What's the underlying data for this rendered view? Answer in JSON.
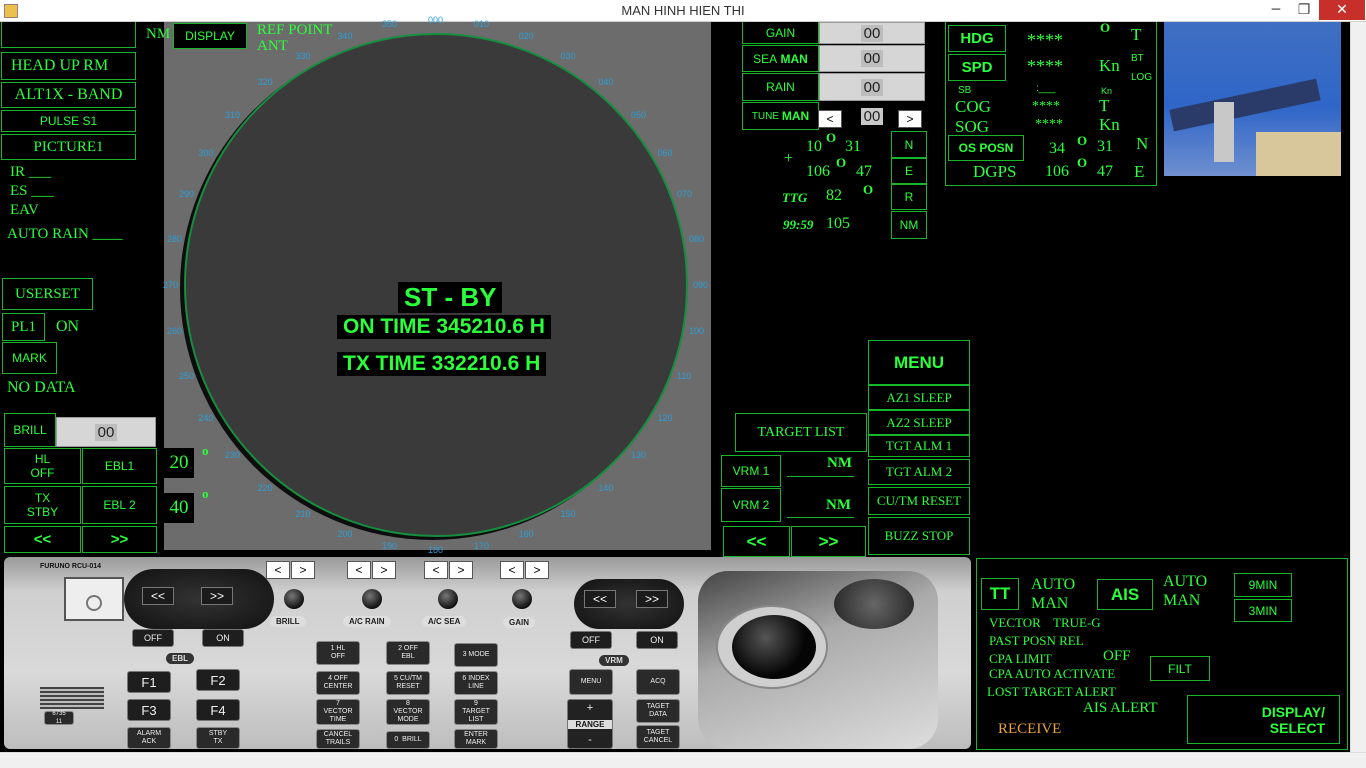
{
  "window": {
    "title": "MAN HINH HIEN THI",
    "min": "─",
    "restore": "❐",
    "close": "✕"
  },
  "left": {
    "nm": "NM",
    "display": "DISPLAY",
    "ref_point": "REF POINT",
    "ant": "ANT",
    "head_up": "HEAD UP  RM",
    "band": "ALT1X - BAND",
    "pulse": "PULSE S1",
    "picture": "PICTURE1",
    "ir": "IR ___",
    "es": "ES ___",
    "eav": "EAV",
    "auto_rain": "AUTO RAIN ____",
    "userset": "USERSET",
    "pl1": "PL1",
    "on": "ON",
    "mark": "MARK",
    "no_data": "NO DATA",
    "brill": "BRILL",
    "brill_val": "00",
    "hl_off": "HL\nOFF",
    "ebl1": "EBL1",
    "tx_stby": "TX\nSTBY",
    "ebl2": "EBL 2",
    "prev": "<<",
    "next": ">>",
    "ebl_deg1": "20",
    "ebl_deg2": "40",
    "deg_sym": "o"
  },
  "scope": {
    "status": "ST - BY",
    "on_time": "ON TIME 345210.6 H",
    "tx_time": "TX TIME 332210.6 H",
    "bearings": [
      "000",
      "010",
      "020",
      "030",
      "040",
      "050",
      "060",
      "070",
      "080",
      "090",
      "100",
      "110",
      "120",
      "130",
      "140",
      "150",
      "160",
      "170",
      "180",
      "190",
      "200",
      "210",
      "220",
      "230",
      "240",
      "250",
      "260",
      "270",
      "280",
      "290",
      "300",
      "310",
      "320",
      "330",
      "340",
      "350"
    ]
  },
  "controls": {
    "gain": "GAIN",
    "gain_val": "00",
    "sea": "SEA",
    "sea_mode": "MAN",
    "sea_val": "00",
    "rain": "RAIN",
    "rain_val": "00",
    "tune": "TUNE",
    "tune_mode": "MAN",
    "tune_val": "00",
    "lt": "<",
    "gt": ">",
    "plus": "+",
    "lat1": "10",
    "lat2": "31",
    "lon1": "106",
    "lon2": "47",
    "ttg": "TTG",
    "ttg_val": "82",
    "time": "99:59",
    "time_val": "105",
    "n": "N",
    "e": "E",
    "r": "R",
    "nm": "NM",
    "deg": "O"
  },
  "nav": {
    "hdg": "HDG",
    "hdg_val": "****",
    "spd": "SPD",
    "spd_val": "****",
    "kn": "Kn",
    "t": "T",
    "bt": "BT",
    "log": "LOG",
    "deg": "O",
    "sb": "SB",
    "sb_val": ":___",
    "kn_small": "Kn",
    "cog": "COG",
    "cog_val": "****",
    "sog": "SOG",
    "sog_val": "****",
    "os_posn": "OS POSN",
    "lat1": "34",
    "lat2": "31",
    "n": "N",
    "dgps": "DGPS",
    "lon1": "106",
    "lon2": "47",
    "e": "E"
  },
  "menu": {
    "title": "MENU",
    "items": [
      "AZ1  SLEEP",
      "AZ2  SLEEP",
      "TGT ALM 1",
      "TGT ALM 2",
      "CU/TM RESET",
      "BUZZ STOP"
    ],
    "target_list": "TARGET LIST",
    "vrm1": "VRM 1",
    "vrm2": "VRM 2",
    "nm": "NM",
    "prev": "<<",
    "next": ">>"
  },
  "ais": {
    "tt": "TT",
    "auto": "AUTO",
    "man": "MAN",
    "ais": "AIS",
    "min9": "9MIN",
    "min3": "3MIN",
    "vector": "VECTOR",
    "true_g": "TRUE-G",
    "past_posn": "PAST POSN REL",
    "cpa_limit": "CPA LIMIT",
    "off": "OFF",
    "filt": "FILT",
    "cpa_auto": "CPA AUTO ACTIVATE",
    "lost_target": "LOST TARGET ALERT",
    "ais_alert": "AIS ALERT",
    "receive": "RECEIVE",
    "display_select": "DISPLAY/\nSELECT"
  },
  "keyboard": {
    "brand": "FURUNO  RCU-014",
    "brill": "BRILL",
    "ac_rain": "A/C RAIN",
    "ac_sea": "A/C SEA",
    "gain": "GAIN",
    "off": "OFF",
    "on": "ON",
    "ebl": "EBL",
    "vrm": "VRM",
    "lt": "<",
    "gt": ">",
    "prev": "<<",
    "next": ">>",
    "f1": "F1",
    "f2": "F2",
    "f3": "F3",
    "f4": "F4",
    "alarm_ack": "ALARM\nACK",
    "stby_tx": "STBY\nTX",
    "k1": "1 HL\nOFF",
    "k2": "2 OFF\nEBL",
    "k3": "3 MODE",
    "k4": "4 OFF\nCENTER",
    "k5": "5 CU/TM\nRESET",
    "k6": "6 INDEX\nLINE",
    "k7": "7\nVECTOR\nTIME",
    "k8": "8\nVECTOR\nMODE",
    "k9": "9\nTARGET\nLIST",
    "k_cancel": "CANCEL\nTRAILS",
    "k0": "0  BRILL",
    "k_enter": "ENTER\nMARK",
    "menu": "MENU",
    "acq": "ACQ",
    "plus": "+",
    "range": "RANGE",
    "minus": "-",
    "target_data": "TAGET\nDATA",
    "target_cancel": "TAGET\nCANCEL",
    "serial": "6735\n11"
  }
}
